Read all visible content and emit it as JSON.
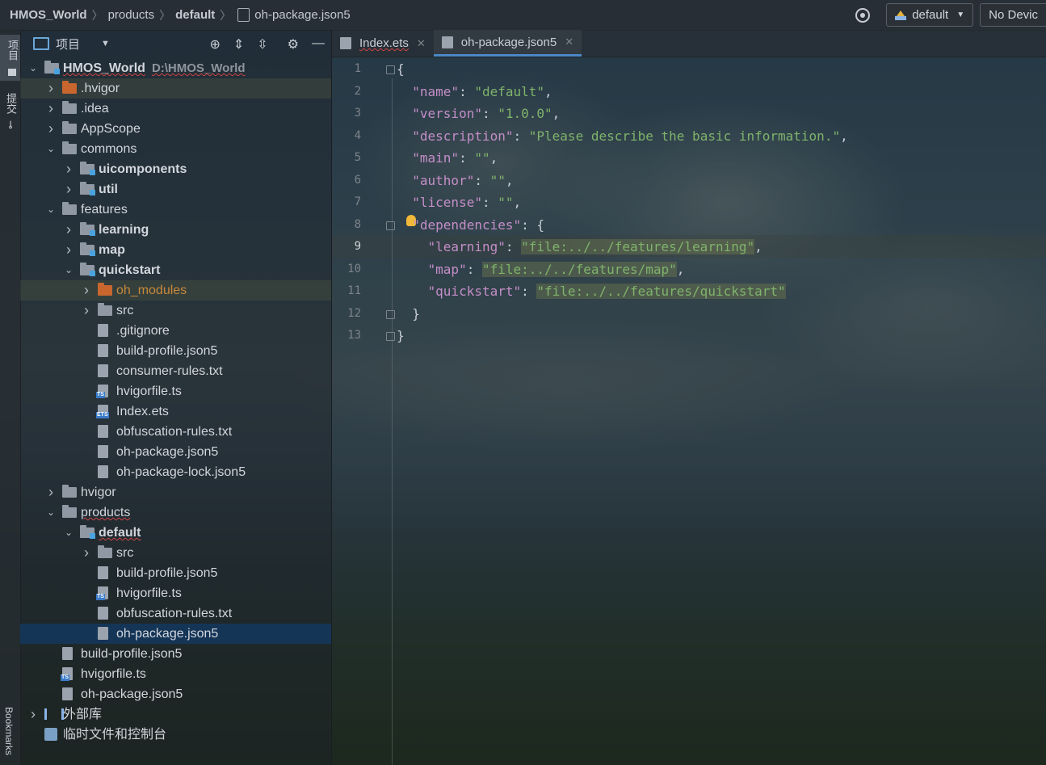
{
  "breadcrumb": {
    "items": [
      {
        "label": "HMOS_World",
        "bold": true
      },
      {
        "label": "products",
        "bold": false
      },
      {
        "label": "default",
        "bold": true
      },
      {
        "label": "oh-package.json5",
        "bold": false
      }
    ]
  },
  "toolbar": {
    "config_label": "default",
    "device_label": "No Devic"
  },
  "left_strip": {
    "project_tab": "项目",
    "commit_tab": "提交",
    "bookmarks_tab": "Bookmarks"
  },
  "panel": {
    "title": "项目"
  },
  "tree": [
    {
      "label": "HMOS_World",
      "path": "D:\\HMOS_World",
      "depth": 0,
      "arrow": "down",
      "icon": "folder-module",
      "bold": true,
      "squig": true
    },
    {
      "label": ".hvigor",
      "depth": 1,
      "arrow": "right",
      "icon": "folder-orange",
      "hl": true
    },
    {
      "label": ".idea",
      "depth": 1,
      "arrow": "right",
      "icon": "folder"
    },
    {
      "label": "AppScope",
      "depth": 1,
      "arrow": "right",
      "icon": "folder"
    },
    {
      "label": "commons",
      "depth": 1,
      "arrow": "down",
      "icon": "folder"
    },
    {
      "label": "uicomponents",
      "depth": 2,
      "arrow": "right",
      "icon": "folder-module",
      "bold": true
    },
    {
      "label": "util",
      "depth": 2,
      "arrow": "right",
      "icon": "folder-module",
      "bold": true
    },
    {
      "label": "features",
      "depth": 1,
      "arrow": "down",
      "icon": "folder"
    },
    {
      "label": "learning",
      "depth": 2,
      "arrow": "right",
      "icon": "folder-module",
      "bold": true
    },
    {
      "label": "map",
      "depth": 2,
      "arrow": "right",
      "icon": "folder-module",
      "bold": true
    },
    {
      "label": "quickstart",
      "depth": 2,
      "arrow": "down",
      "icon": "folder-module",
      "bold": true
    },
    {
      "label": "oh_modules",
      "depth": 3,
      "arrow": "right",
      "icon": "folder-orange",
      "orange": true,
      "hl": true
    },
    {
      "label": "src",
      "depth": 3,
      "arrow": "right",
      "icon": "folder"
    },
    {
      "label": ".gitignore",
      "depth": 3,
      "icon": "file"
    },
    {
      "label": "build-profile.json5",
      "depth": 3,
      "icon": "file"
    },
    {
      "label": "consumer-rules.txt",
      "depth": 3,
      "icon": "file"
    },
    {
      "label": "hvigorfile.ts",
      "depth": 3,
      "icon": "file-ts"
    },
    {
      "label": "Index.ets",
      "depth": 3,
      "icon": "file-ets"
    },
    {
      "label": "obfuscation-rules.txt",
      "depth": 3,
      "icon": "file"
    },
    {
      "label": "oh-package.json5",
      "depth": 3,
      "icon": "file"
    },
    {
      "label": "oh-package-lock.json5",
      "depth": 3,
      "icon": "file"
    },
    {
      "label": "hvigor",
      "depth": 1,
      "arrow": "right",
      "icon": "folder"
    },
    {
      "label": "products",
      "depth": 1,
      "arrow": "down",
      "icon": "folder",
      "squig": true
    },
    {
      "label": "default",
      "depth": 2,
      "arrow": "down",
      "icon": "folder-module",
      "bold": true,
      "squig": true
    },
    {
      "label": "src",
      "depth": 3,
      "arrow": "right",
      "icon": "folder"
    },
    {
      "label": "build-profile.json5",
      "depth": 3,
      "icon": "file"
    },
    {
      "label": "hvigorfile.ts",
      "depth": 3,
      "icon": "file-ts"
    },
    {
      "label": "obfuscation-rules.txt",
      "depth": 3,
      "icon": "file"
    },
    {
      "label": "oh-package.json5",
      "depth": 3,
      "icon": "file",
      "selected": true
    },
    {
      "label": "build-profile.json5",
      "depth": 1,
      "icon": "file"
    },
    {
      "label": "hvigorfile.ts",
      "depth": 1,
      "icon": "file-ts"
    },
    {
      "label": "oh-package.json5",
      "depth": 1,
      "icon": "file"
    },
    {
      "label": "外部库",
      "depth": 0,
      "arrow": "right",
      "icon": "library"
    },
    {
      "label": "临时文件和控制台",
      "depth": 0,
      "icon": "scratch"
    }
  ],
  "tabs": [
    {
      "label": "Index.ets",
      "active": false
    },
    {
      "label": "oh-package.json5",
      "active": true
    }
  ],
  "editor": {
    "current_line": 9,
    "lines": [
      [
        {
          "t": "{",
          "c": "p"
        }
      ],
      [
        {
          "t": "  \"name\"",
          "c": "k"
        },
        {
          "t": ": ",
          "c": "p"
        },
        {
          "t": "\"default\"",
          "c": "s"
        },
        {
          "t": ",",
          "c": "p"
        }
      ],
      [
        {
          "t": "  \"version\"",
          "c": "k"
        },
        {
          "t": ": ",
          "c": "p"
        },
        {
          "t": "\"1.0.0\"",
          "c": "s"
        },
        {
          "t": ",",
          "c": "p"
        }
      ],
      [
        {
          "t": "  \"description\"",
          "c": "k"
        },
        {
          "t": ": ",
          "c": "p"
        },
        {
          "t": "\"Please describe the basic information.\"",
          "c": "s"
        },
        {
          "t": ",",
          "c": "p"
        }
      ],
      [
        {
          "t": "  \"main\"",
          "c": "k"
        },
        {
          "t": ": ",
          "c": "p"
        },
        {
          "t": "\"\"",
          "c": "s"
        },
        {
          "t": ",",
          "c": "p"
        }
      ],
      [
        {
          "t": "  \"author\"",
          "c": "k"
        },
        {
          "t": ": ",
          "c": "p"
        },
        {
          "t": "\"\"",
          "c": "s"
        },
        {
          "t": ",",
          "c": "p"
        }
      ],
      [
        {
          "t": "  \"license\"",
          "c": "k"
        },
        {
          "t": ": ",
          "c": "p"
        },
        {
          "t": "\"\"",
          "c": "s"
        },
        {
          "t": ",",
          "c": "p"
        }
      ],
      [
        {
          "t": "  \"dependencies\"",
          "c": "k"
        },
        {
          "t": ": {",
          "c": "p"
        }
      ],
      [
        {
          "t": "    \"learning\"",
          "c": "k"
        },
        {
          "t": ": ",
          "c": "p"
        },
        {
          "t": "\"file:../../features/learning\"",
          "c": "hls"
        },
        {
          "t": ",",
          "c": "p"
        }
      ],
      [
        {
          "t": "    \"map\"",
          "c": "k"
        },
        {
          "t": ": ",
          "c": "p"
        },
        {
          "t": "\"file:../../features/map\"",
          "c": "hls"
        },
        {
          "t": ",",
          "c": "p"
        }
      ],
      [
        {
          "t": "    \"quickstart\"",
          "c": "k"
        },
        {
          "t": ": ",
          "c": "p"
        },
        {
          "t": "\"file:../../features/quickstart\"",
          "c": "hls"
        }
      ],
      [
        {
          "t": "  }",
          "c": "p"
        }
      ],
      [
        {
          "t": "}",
          "c": "p"
        }
      ]
    ]
  }
}
